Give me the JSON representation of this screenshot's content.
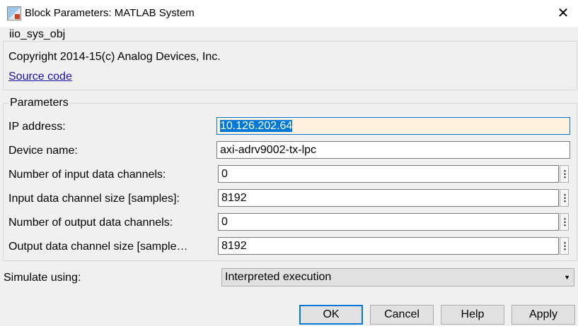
{
  "window": {
    "title": "Block Parameters: MATLAB System",
    "close_icon": "close-icon"
  },
  "info": {
    "group_title": "iio_sys_obj",
    "copyright": "Copyright 2014-15(c) Analog Devices, Inc.",
    "source_link": "Source code"
  },
  "parameters": {
    "group_title": "Parameters",
    "ip_address": {
      "label": "IP address:",
      "value": "10.126.202.64"
    },
    "device_name": {
      "label": "Device name:",
      "value": "axi-adrv9002-tx-lpc"
    },
    "rows": [
      {
        "label": "Number of input data channels:",
        "value": "0"
      },
      {
        "label": "Input data channel size [samples]:",
        "value": "8192"
      },
      {
        "label": "Number of output data channels:",
        "value": "0"
      },
      {
        "label": "Output data channel size [sample…",
        "value": "8192"
      }
    ],
    "more_glyph": "⋮"
  },
  "simulate": {
    "label": "Simulate using:",
    "value": "Interpreted execution"
  },
  "buttons": {
    "ok": "OK",
    "cancel": "Cancel",
    "help": "Help",
    "apply": "Apply"
  }
}
